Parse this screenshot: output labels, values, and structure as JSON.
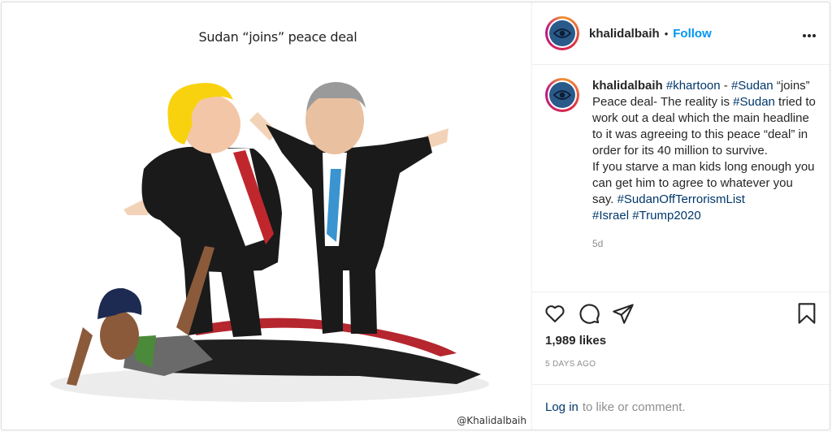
{
  "post": {
    "image": {
      "headline": "Sudan “joins” peace deal",
      "signature": "@Khalidalbaih"
    },
    "header": {
      "username": "khalidalbaih",
      "separator": "•",
      "follow_label": "Follow",
      "more_label": "•••",
      "avatar_icon": "eye-icon"
    },
    "caption": {
      "username": "khalidalbaih",
      "segments": [
        {
          "t": "#khartoon",
          "tag": true
        },
        {
          "t": " - ",
          "tag": false
        },
        {
          "t": "#Sudan",
          "tag": true
        },
        {
          "t": " “joins” Peace deal- The reality is ",
          "tag": false
        },
        {
          "t": "#Sudan",
          "tag": true
        },
        {
          "t": " tried to work out a deal which the main headline to it was agreeing to this peace “deal” in order for its 40 million to survive.",
          "tag": false
        },
        {
          "t": "If you starve a man kids long enough you can get him to agree to whatever you say. ",
          "tag": false
        },
        {
          "t": "#SudanOffTerrorismList",
          "tag": true
        },
        {
          "t": "#Israel",
          "tag": true
        },
        {
          "t": " ",
          "tag": false
        },
        {
          "t": "#Trump2020",
          "tag": true
        }
      ],
      "time": "5d"
    },
    "actions": {
      "like_icon": "heart-icon",
      "comment_icon": "comment-icon",
      "share_icon": "share-icon",
      "save_icon": "bookmark-icon"
    },
    "likes": "1,989 likes",
    "posted_ago": "5 DAYS AGO",
    "login": {
      "link": "Log in",
      "rest": "to like or comment."
    },
    "colors": {
      "link_blue": "#0095f6",
      "hashtag": "#00376b",
      "muted": "#8e8e8e"
    }
  }
}
